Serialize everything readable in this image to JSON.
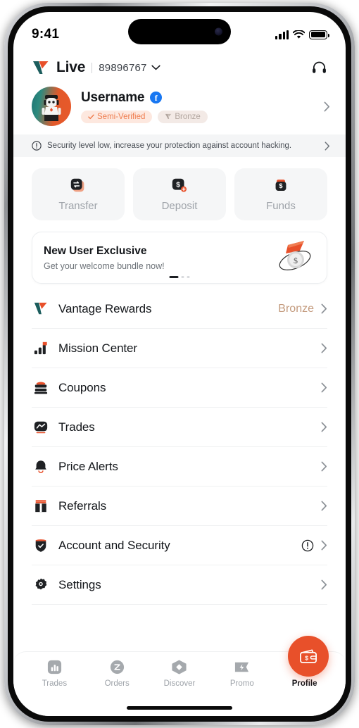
{
  "status_bar": {
    "time": "9:41",
    "signal_icon": "cellular-bars-icon",
    "wifi_icon": "wifi-icon",
    "battery_icon": "battery-icon"
  },
  "header": {
    "logo_icon": "vantage-logo-icon",
    "brand": "Live",
    "account_number": "89896767",
    "chevron_icon": "chevron-down-icon",
    "support_icon": "headset-support-icon"
  },
  "profile": {
    "avatar_icon": "avatar-robot-image",
    "username": "Username",
    "social_badge": "f",
    "social_badge_icon": "facebook-icon",
    "tags": [
      {
        "label": "Semi-Verified",
        "icon": "check-icon",
        "style": "verified"
      },
      {
        "label": "Bronze",
        "icon": "vantage-mark-icon",
        "style": "bronze"
      }
    ],
    "chevron_icon": "chevron-right-icon"
  },
  "security_banner": {
    "icon": "exclamation-circle-icon",
    "text": "Security level low, increase your protection against account hacking.",
    "chevron_icon": "chevron-right-icon"
  },
  "quick_actions": [
    {
      "label": "Transfer",
      "icon": "transfer-icon"
    },
    {
      "label": "Deposit",
      "icon": "deposit-icon"
    },
    {
      "label": "Funds",
      "icon": "funds-icon"
    }
  ],
  "promo": {
    "title": "New User Exclusive",
    "subtitle": "Get your welcome bundle now!",
    "art_icon": "coin-orbit-illustration",
    "dots_total": 3,
    "dots_active_index": 0
  },
  "menu": [
    {
      "label": "Vantage Rewards",
      "icon": "vantage-mark-icon",
      "value": "Bronze",
      "warn": false
    },
    {
      "label": "Mission Center",
      "icon": "bar-chart-flag-icon",
      "value": "",
      "warn": false
    },
    {
      "label": "Coupons",
      "icon": "coupon-ticket-icon",
      "value": "",
      "warn": false
    },
    {
      "label": "Trades",
      "icon": "trades-chart-icon",
      "value": "",
      "warn": false
    },
    {
      "label": "Price Alerts",
      "icon": "bell-icon",
      "value": "",
      "warn": false
    },
    {
      "label": "Referrals",
      "icon": "gift-icon",
      "value": "",
      "warn": false
    },
    {
      "label": "Account and Security",
      "icon": "shield-check-icon",
      "value": "",
      "warn": true
    },
    {
      "label": "Settings",
      "icon": "gear-icon",
      "value": "",
      "warn": false
    }
  ],
  "fab": {
    "icon": "wallet-icon"
  },
  "bottom_nav": [
    {
      "label": "Trades",
      "icon": "bar-chart-icon",
      "active": false,
      "dot": false
    },
    {
      "label": "Orders",
      "icon": "orders-icon",
      "active": false,
      "dot": false
    },
    {
      "label": "Discover",
      "icon": "discover-diamond-icon",
      "active": false,
      "dot": false
    },
    {
      "label": "Promo",
      "icon": "promo-bolt-icon",
      "active": false,
      "dot": false
    },
    {
      "label": "Profile",
      "icon": "person-icon",
      "active": true,
      "dot": true
    }
  ],
  "colors": {
    "brand_orange": "#E8502A",
    "brand_teal": "#1E6E6E",
    "bronze": "#C39A7D",
    "verified_tag_bg": "#FDE8DF",
    "verified_tag_text": "#EF7D4F",
    "text_primary": "#13161A",
    "text_muted": "#9EA3A9",
    "surface_grey": "#F5F6F7"
  }
}
